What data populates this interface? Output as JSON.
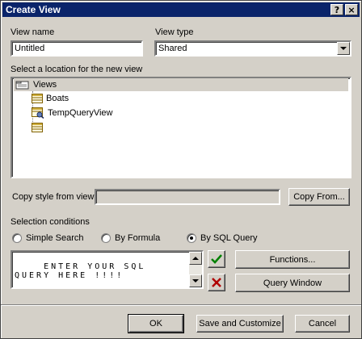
{
  "window": {
    "title": "Create View",
    "help_glyph": "?",
    "close_glyph": "×"
  },
  "view_name": {
    "label": "View name",
    "value": "Untitled"
  },
  "view_type": {
    "label": "View type",
    "selected": "Shared"
  },
  "location": {
    "label": "Select a location for the new view",
    "tree": [
      {
        "label": "Views",
        "icon": "folder-icon"
      },
      {
        "label": "Boats",
        "icon": "table-icon"
      },
      {
        "label": "TempQueryView",
        "icon": "query-view-icon"
      },
      {
        "label": "",
        "icon": "table-icon"
      }
    ]
  },
  "copy_style": {
    "label": "Copy style from view",
    "value": "",
    "button": "Copy From..."
  },
  "selection": {
    "label": "Selection conditions",
    "options": [
      {
        "label": "Simple Search",
        "selected": false
      },
      {
        "label": "By Formula",
        "selected": false
      },
      {
        "label": "By SQL Query",
        "selected": true
      }
    ],
    "query_text": "ENTER YOUR SQL QUERY HERE !!!!",
    "functions_button": "Functions...",
    "query_window_button": "Query Window",
    "accept_color": "#008000",
    "reject_color": "#b00000"
  },
  "footer": {
    "ok": "OK",
    "save_customize": "Save and Customize",
    "cancel": "Cancel"
  }
}
